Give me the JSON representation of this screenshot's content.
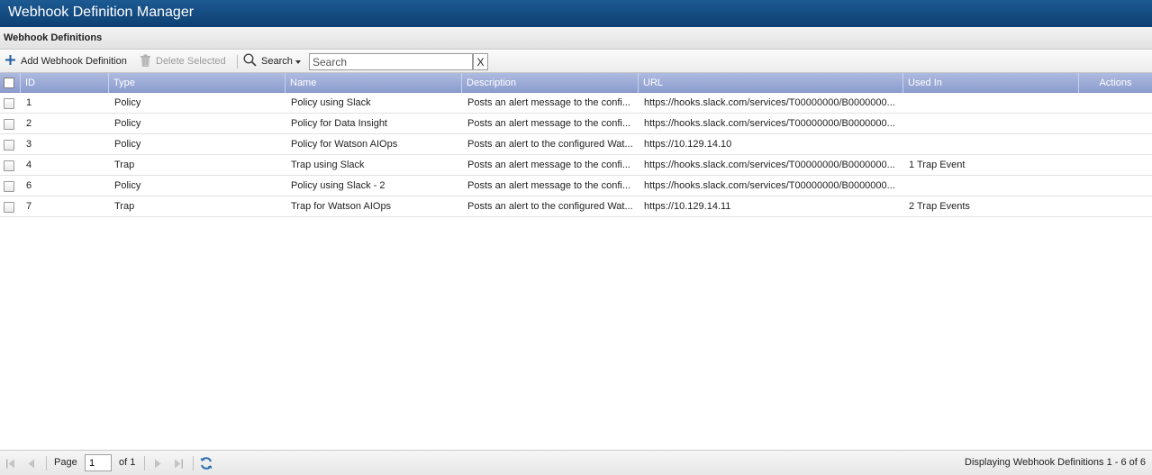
{
  "window": {
    "title": "Webhook Definition Manager"
  },
  "panel": {
    "title": "Webhook Definitions"
  },
  "toolbar": {
    "add_label": "Add Webhook Definition",
    "delete_label": "Delete Selected",
    "search_label": "Search",
    "search_placeholder": "Search",
    "search_value": "",
    "clear_label": "X"
  },
  "grid": {
    "columns": {
      "id": "ID",
      "type": "Type",
      "name": "Name",
      "description": "Description",
      "url": "URL",
      "used_in": "Used In",
      "actions": "Actions"
    },
    "rows": [
      {
        "id": "1",
        "type": "Policy",
        "name": "Policy using Slack",
        "description": "Posts an alert message to the confi...",
        "url": "https://hooks.slack.com/services/T00000000/B0000000...",
        "used_in": ""
      },
      {
        "id": "2",
        "type": "Policy",
        "name": "Policy for Data Insight",
        "description": "Posts an alert message to the confi...",
        "url": "https://hooks.slack.com/services/T00000000/B0000000...",
        "used_in": ""
      },
      {
        "id": "3",
        "type": "Policy",
        "name": "Policy for Watson AIOps",
        "description": "Posts an alert to the configured Wat...",
        "url": "https://10.129.14.10",
        "used_in": ""
      },
      {
        "id": "4",
        "type": "Trap",
        "name": "Trap using Slack",
        "description": "Posts an alert message to the confi...",
        "url": "https://hooks.slack.com/services/T00000000/B0000000...",
        "used_in": "1 Trap Event"
      },
      {
        "id": "6",
        "type": "Policy",
        "name": "Policy using Slack - 2",
        "description": "Posts an alert message to the confi...",
        "url": "https://hooks.slack.com/services/T00000000/B0000000...",
        "used_in": ""
      },
      {
        "id": "7",
        "type": "Trap",
        "name": "Trap for Watson AIOps",
        "description": "Posts an alert to the configured Wat...",
        "url": "https://10.129.14.11",
        "used_in": "2 Trap Events"
      }
    ]
  },
  "pager": {
    "page_label": "Page",
    "page_value": "1",
    "of_label": "of 1",
    "status": "Displaying Webhook Definitions 1 - 6 of 6"
  },
  "colors": {
    "title_bar": "#0d3f72",
    "grid_header": "#8c9dce",
    "add_icon": "#1e5aa0"
  }
}
